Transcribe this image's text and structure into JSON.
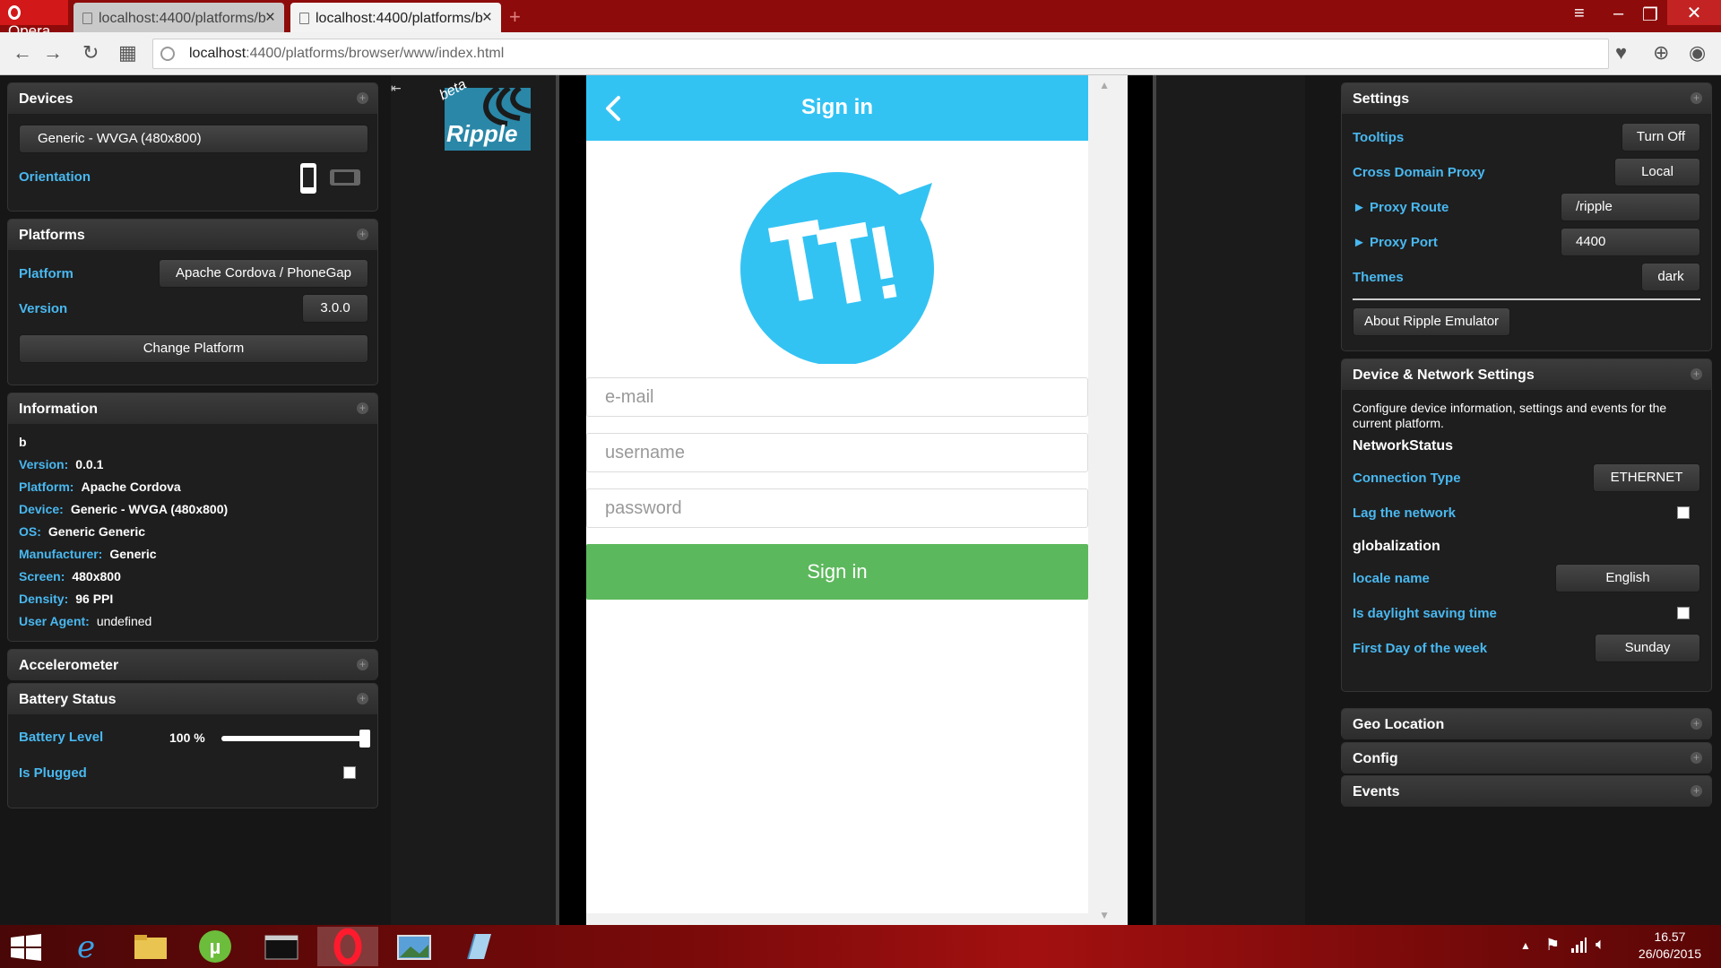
{
  "browser": {
    "menu_label": "Opera",
    "tabs": [
      {
        "title": "localhost:4400/platforms/b"
      },
      {
        "title": "localhost:4400/platforms/b"
      }
    ],
    "url_host": "localhost",
    "url_rest": ":4400/platforms/browser/www/index.html"
  },
  "left": {
    "devices": {
      "title": "Devices",
      "device": "Generic - WVGA (480x800)",
      "orientation_label": "Orientation"
    },
    "platforms": {
      "title": "Platforms",
      "platform_label": "Platform",
      "platform_value": "Apache Cordova / PhoneGap",
      "version_label": "Version",
      "version_value": "3.0.0",
      "change_button": "Change Platform"
    },
    "information": {
      "title": "Information",
      "app_name": "b",
      "rows": [
        {
          "k": "Version:",
          "v": "0.0.1"
        },
        {
          "k": "Platform:",
          "v": "Apache Cordova"
        },
        {
          "k": "Device:",
          "v": "Generic - WVGA (480x800)"
        },
        {
          "k": "OS:",
          "v": "Generic Generic"
        },
        {
          "k": "Manufacturer:",
          "v": "Generic"
        },
        {
          "k": "Screen:",
          "v": "480x800"
        },
        {
          "k": "Density:",
          "v": "96 PPI"
        },
        {
          "k": "User Agent:",
          "v": "undefined"
        }
      ]
    },
    "accelerometer": {
      "title": "Accelerometer"
    },
    "battery": {
      "title": "Battery Status",
      "level_label": "Battery Level",
      "level_value": "100 %",
      "level_fraction": 1.0,
      "plugged_label": "Is Plugged"
    }
  },
  "ripple_logo": {
    "text": "Ripple",
    "badge": "beta"
  },
  "app": {
    "header_title": "Sign in",
    "email_placeholder": "e-mail",
    "username_placeholder": "username",
    "password_placeholder": "password",
    "signin_button": "Sign in",
    "brand_color": "#33c3f3",
    "button_color": "#5cb85c"
  },
  "right": {
    "settings": {
      "title": "Settings",
      "tooltips_label": "Tooltips",
      "tooltips_value": "Turn Off",
      "proxy_label": "Cross Domain Proxy",
      "proxy_value": "Local",
      "route_label": "► Proxy Route",
      "route_value": "/ripple",
      "port_label": "► Proxy Port",
      "port_value": "4400",
      "themes_label": "Themes",
      "themes_value": "dark",
      "about_button": "About Ripple Emulator"
    },
    "device_network": {
      "title": "Device & Network Settings",
      "description": "Configure device information, settings and events for the current platform.",
      "network_heading": "NetworkStatus",
      "connection_label": "Connection Type",
      "connection_value": "ETHERNET",
      "lag_label": "Lag the network",
      "glob_heading": "globalization",
      "locale_label": "locale name",
      "locale_value": "English",
      "dst_label": "Is daylight saving time",
      "firstday_label": "First Day of the week",
      "firstday_value": "Sunday"
    },
    "geo": {
      "title": "Geo Location"
    },
    "config": {
      "title": "Config"
    },
    "events": {
      "title": "Events"
    }
  },
  "taskbar": {
    "time": "16.57",
    "date": "26/06/2015"
  },
  "accent_color": "#49b8f0"
}
